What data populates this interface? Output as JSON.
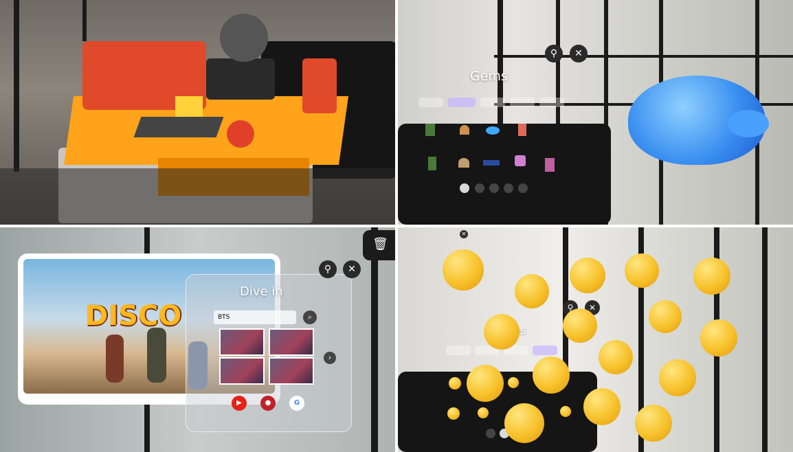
{
  "gems_panel": {
    "title": "Gems"
  },
  "video_panel": {
    "title": "Dive in",
    "search_value": "BTS",
    "video_banner": "DISCO"
  },
  "emoji_panel": {
    "title": "Gems"
  },
  "icons": {
    "pin": "pin-icon",
    "close": "close-icon",
    "trash": "trash-icon",
    "search": "search-icon",
    "next": "chevron-right-icon"
  },
  "colors": {
    "accent_tab": "#c8b4ff",
    "youtube": "#e62117",
    "google": "#ffffff",
    "emoji_yellow": "#f7c12a"
  }
}
